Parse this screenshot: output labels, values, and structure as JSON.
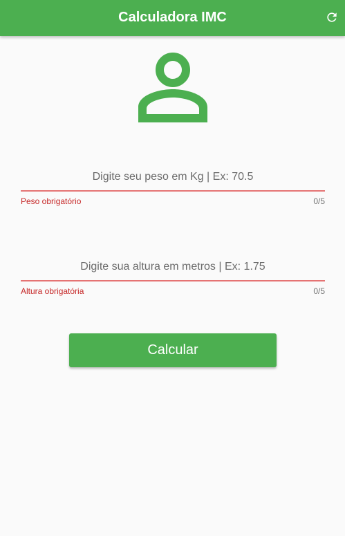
{
  "appbar": {
    "title": "Calculadora IMC",
    "refresh_icon": "refresh-icon",
    "color": "#4caf50"
  },
  "avatar": {
    "icon": "person-icon",
    "color": "#4caf50"
  },
  "weight_field": {
    "placeholder": "Digite seu peso em Kg | Ex: 70.5",
    "value": "",
    "error": "Peso obrigatório",
    "counter": "0/5"
  },
  "height_field": {
    "placeholder": "Digite sua altura em metros | Ex: 1.75",
    "value": "",
    "error": "Altura obrigatória",
    "counter": "0/5"
  },
  "calculate_button": {
    "label": "Calcular"
  },
  "colors": {
    "primary": "#4caf50",
    "error": "#c62828",
    "error_underline": "#e57373"
  }
}
